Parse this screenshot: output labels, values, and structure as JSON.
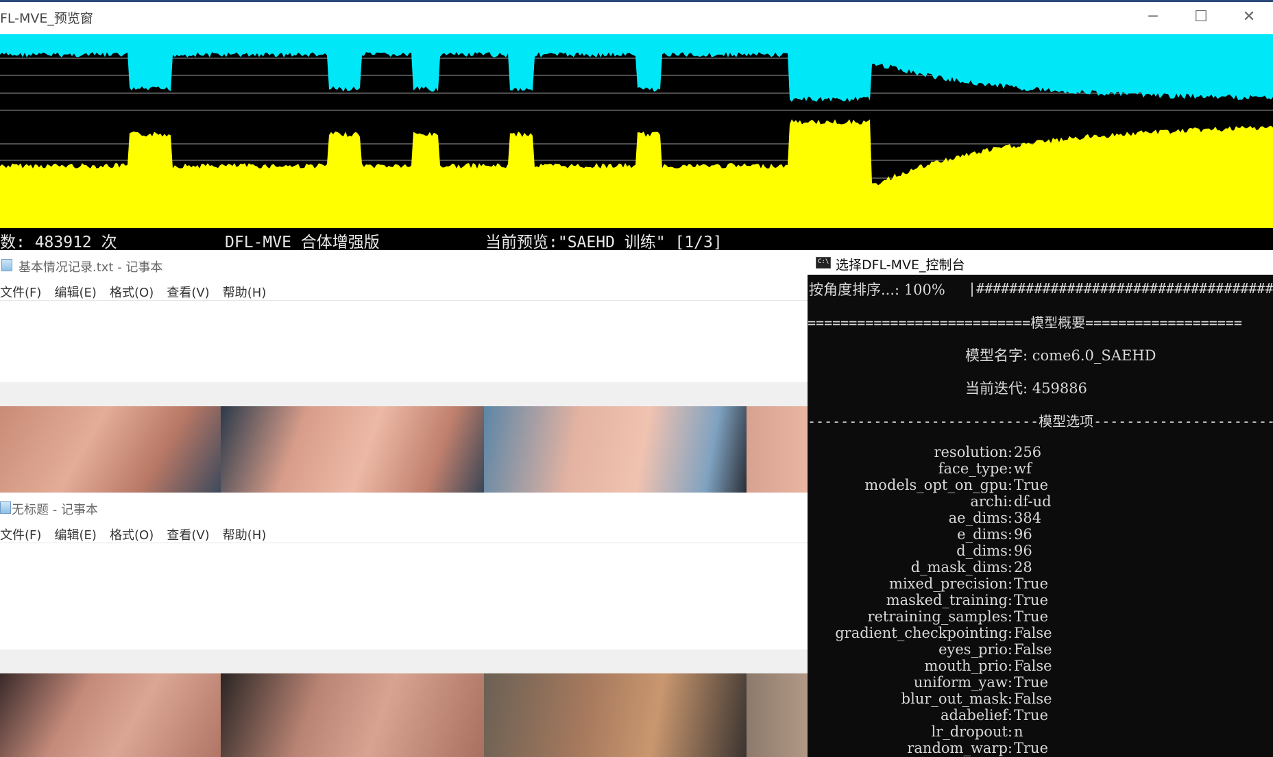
{
  "preview": {
    "title": "FL-MVE_预览窗",
    "controls": {
      "minimize": "─",
      "maximize": "☐",
      "close": "✕"
    },
    "status": {
      "iterations": "数: 483912 次",
      "app_name": "DFL-MVE_合体增强版",
      "current_preview": "当前预览:\"SAEHD 训练\" [1/3]"
    },
    "colors": {
      "src_loss": "#00e8f8",
      "dst_loss": "#ffff00",
      "background": "#000000"
    }
  },
  "notepad1": {
    "title": "基本情况记录.txt - 记事本",
    "menu": [
      "文件(F)",
      "编辑(E)",
      "格式(O)",
      "查看(V)",
      "帮助(H)"
    ]
  },
  "notepad2": {
    "title": "无标题 - 记事本",
    "menu": [
      "文件(F)",
      "编辑(E)",
      "格式(O)",
      "查看(V)",
      "帮助(H)"
    ]
  },
  "console": {
    "title": "选择DFL-MVE_控制台",
    "progress_label": "按角度排序...: 100%",
    "progress_bar": "|##########################################",
    "summary_header": "===========================模型概要===================",
    "model_name_line": "模型名字: come6.0_SAEHD",
    "iteration_line": "当前迭代: 459886",
    "options_header": "----------------------------模型选项----------------------",
    "options": [
      {
        "key": "resolution:",
        "value": "256"
      },
      {
        "key": "face_type:",
        "value": "wf"
      },
      {
        "key": "models_opt_on_gpu:",
        "value": "True"
      },
      {
        "key": "archi:",
        "value": "df-ud"
      },
      {
        "key": "ae_dims:",
        "value": "384"
      },
      {
        "key": "e_dims:",
        "value": "96"
      },
      {
        "key": "d_dims:",
        "value": "96"
      },
      {
        "key": "d_mask_dims:",
        "value": "28"
      },
      {
        "key": "mixed_precision:",
        "value": "True"
      },
      {
        "key": "masked_training:",
        "value": "True"
      },
      {
        "key": "retraining_samples:",
        "value": "True"
      },
      {
        "key": "gradient_checkpointing:",
        "value": "False"
      },
      {
        "key": "eyes_prio:",
        "value": "False"
      },
      {
        "key": "mouth_prio:",
        "value": "False"
      },
      {
        "key": "uniform_yaw:",
        "value": "True"
      },
      {
        "key": "blur_out_mask:",
        "value": "False"
      },
      {
        "key": "adabelief:",
        "value": "True"
      },
      {
        "key": "lr_dropout:",
        "value": "n"
      },
      {
        "key": "random_warp:",
        "value": "True"
      }
    ]
  }
}
